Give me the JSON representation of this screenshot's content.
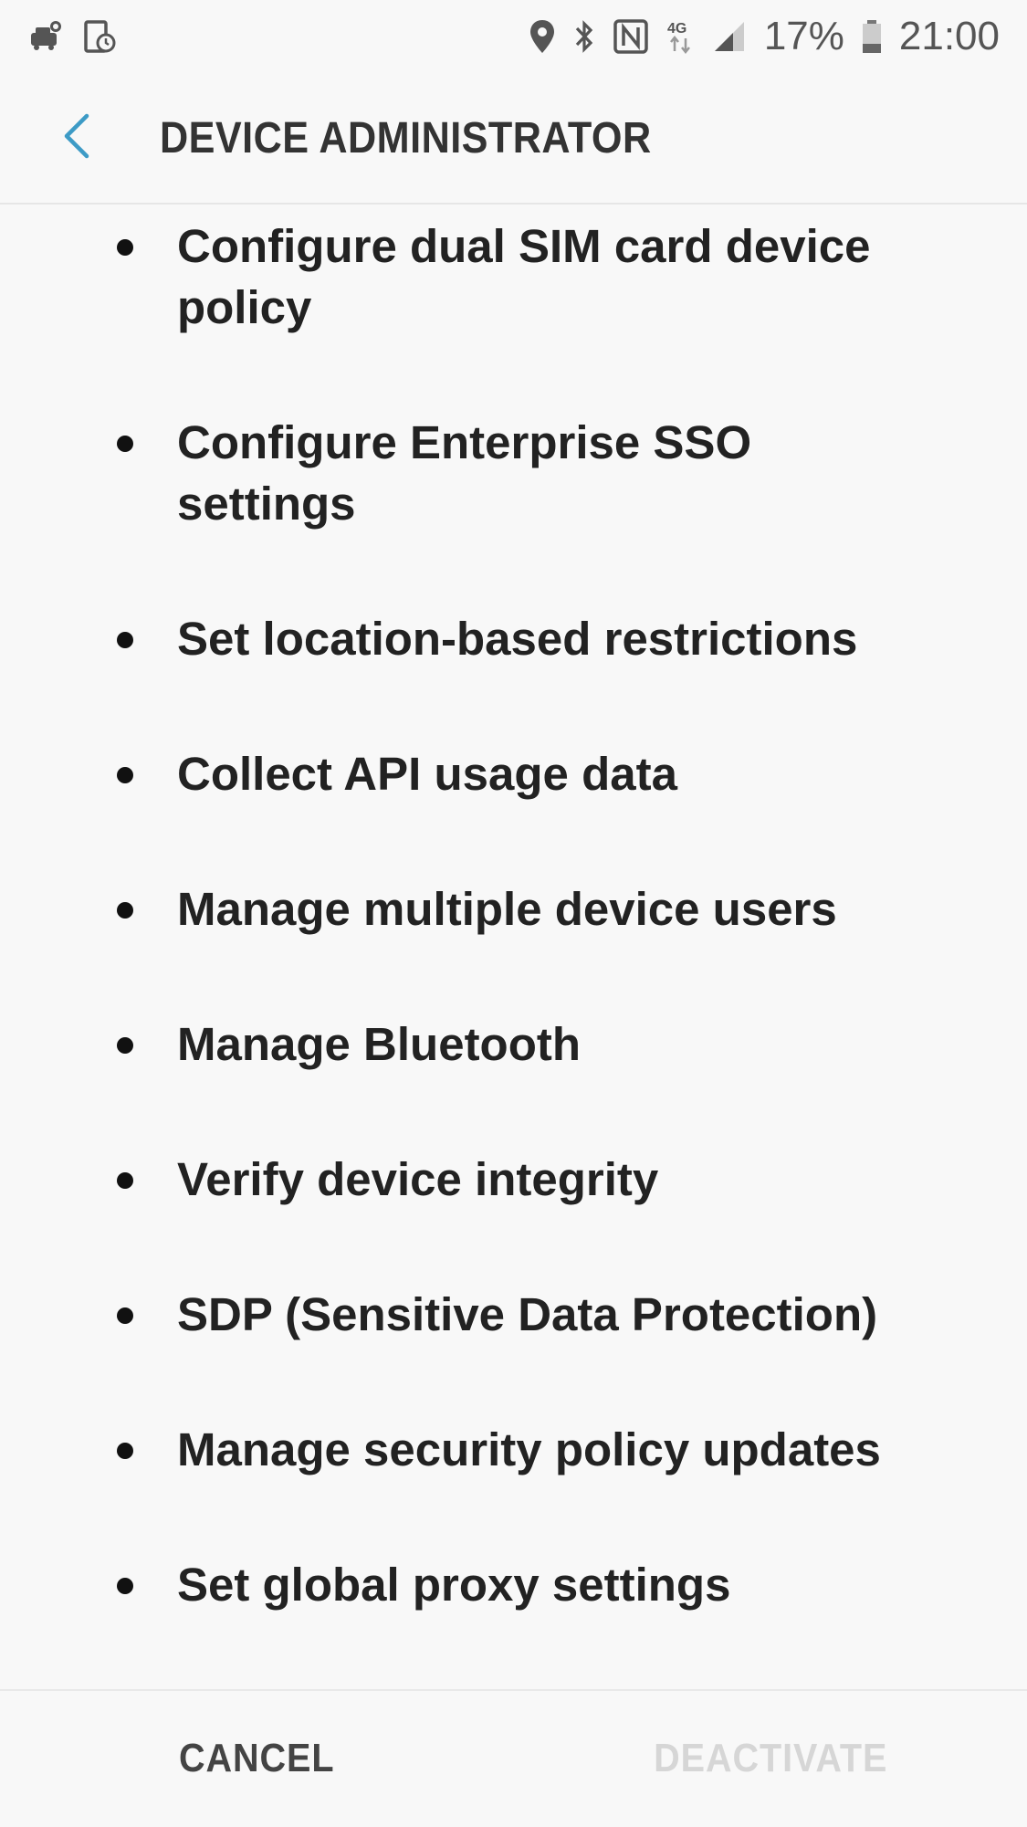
{
  "status_bar": {
    "left_icons": [
      "driving-mode-icon",
      "device-schedule-icon"
    ],
    "right_icons": [
      "location-icon",
      "bluetooth-icon",
      "nfc-icon",
      "network-4g-icon",
      "signal-icon",
      "battery-icon"
    ],
    "network_label": "4G",
    "battery_percent": "17%",
    "time": "21:00"
  },
  "app_bar": {
    "back_icon": "back-chevron-icon",
    "title": "DEVICE ADMINISTRATOR",
    "accent_color": "#3d9bc6"
  },
  "permissions": [
    {
      "label": "Configure dual SIM card device policy"
    },
    {
      "label": "Configure Enterprise SSO settings"
    },
    {
      "label": "Set location-based restrictions"
    },
    {
      "label": "Collect API usage data"
    },
    {
      "label": "Manage multiple device users"
    },
    {
      "label": "Manage Bluetooth"
    },
    {
      "label": "Verify device integrity"
    },
    {
      "label": "SDP (Sensitive Data Protection)"
    },
    {
      "label": "Manage security policy updates"
    },
    {
      "label": "Set global proxy settings"
    }
  ],
  "buttons": {
    "cancel": "CANCEL",
    "deactivate": "DEACTIVATE"
  }
}
